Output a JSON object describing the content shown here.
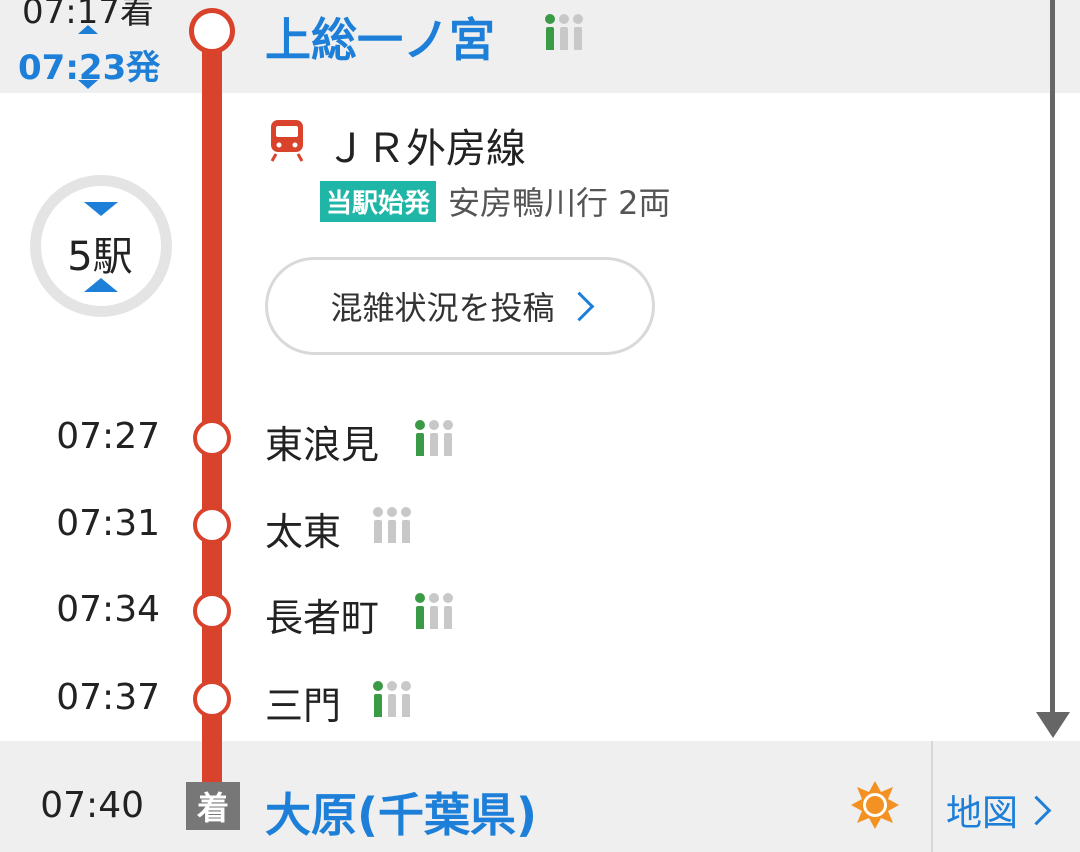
{
  "colors": {
    "line": "#d9432b",
    "accent": "#1e7fd8",
    "badge": "#1fb6a8",
    "congestion_on": "#3a9a46",
    "congestion_off": "#c8c8c8",
    "weather": "#f39222"
  },
  "departure": {
    "arrival_time_partial": "07:17着",
    "departure_time": "07:23発",
    "station": "上総一ノ宮",
    "congestion_level": 1
  },
  "train": {
    "icon": "train-icon",
    "line_name": "ＪＲ外房線",
    "badge": "当駅始発",
    "destination": "安房鴨川行 2両",
    "post_button": "混雑状況を投稿",
    "stop_count": "5駅"
  },
  "stops": [
    {
      "time": "07:27",
      "name": "東浪見",
      "congestion_level": 1
    },
    {
      "time": "07:31",
      "name": "太東",
      "congestion_level": 0
    },
    {
      "time": "07:34",
      "name": "長者町",
      "congestion_level": 1
    },
    {
      "time": "07:37",
      "name": "三門",
      "congestion_level": 1
    }
  ],
  "arrival": {
    "time": "07:40",
    "badge": "着",
    "station": "大原(千葉県)",
    "weather_icon": "sun-icon",
    "map_link": "地図"
  }
}
